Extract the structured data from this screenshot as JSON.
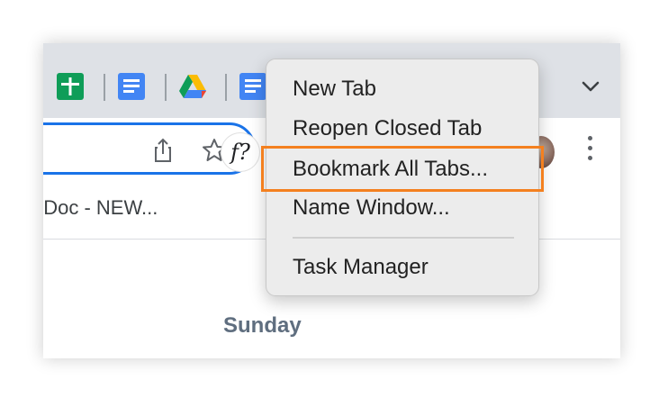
{
  "tabstrip": {
    "tabs": [
      {
        "name": "google-sheets"
      },
      {
        "name": "google-docs"
      },
      {
        "name": "google-drive"
      },
      {
        "name": "google-docs"
      }
    ],
    "chevron_icon": "chevron-down-icon"
  },
  "toolbar": {
    "share_icon": "share-icon",
    "star_icon": "bookmark-star-icon",
    "extension_label": "f?",
    "menu_icon": "three-dot-menu-icon"
  },
  "bookmarks_bar": {
    "item_label": "t Doc - NEW..."
  },
  "page": {
    "day_label": "Sunday"
  },
  "context_menu": {
    "items": [
      {
        "label": "New Tab"
      },
      {
        "label": "Reopen Closed Tab"
      },
      {
        "label": "Bookmark All Tabs..."
      },
      {
        "label": "Name Window..."
      },
      {
        "label": "Task Manager"
      }
    ],
    "highlighted_item": "Bookmark All Tabs..."
  },
  "colors": {
    "tabstrip_bg": "#dee1e6",
    "omnibox_border": "#1a73e8",
    "highlight_border": "#f4801f",
    "menu_bg": "#ececec",
    "sheets_green": "#0f9d58",
    "docs_blue": "#4285f4"
  }
}
